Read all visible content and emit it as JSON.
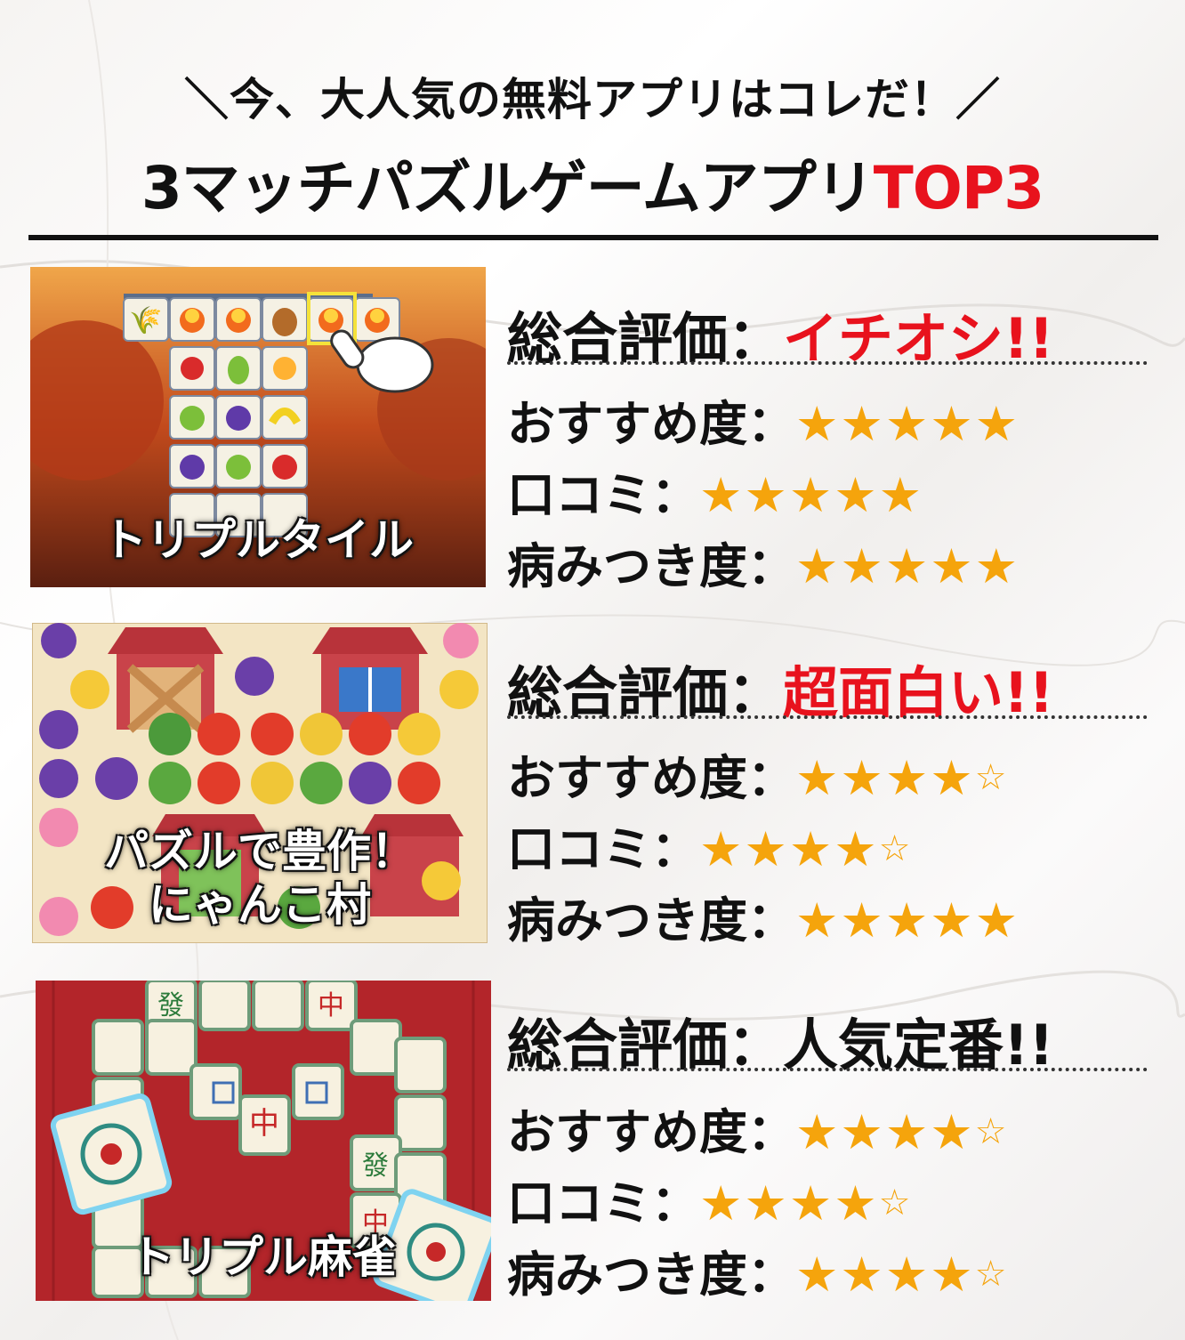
{
  "header": {
    "subtitle": "＼今、大人気の無料アプリはコレだ！／",
    "title_main": "3マッチパズルゲームアプリ",
    "title_accent": "TOP3"
  },
  "labels": {
    "overall": "総合評価：",
    "recommend": "おすすめ度：",
    "reviews": "口コミ：",
    "addictive": "病みつき度："
  },
  "star_colors": {
    "filled": "#f5a40c"
  },
  "apps": [
    {
      "caption_line1": "トリプルタイル",
      "caption_line2": "",
      "verdict": "イチオシ!!",
      "recommend_stars": "★★★★★",
      "recommend_empty": "",
      "reviews_stars": "★★★★★",
      "reviews_empty": "",
      "addictive_stars": "★★★★★",
      "addictive_empty": "",
      "recommend_rating": 5,
      "reviews_rating": 5,
      "addictive_rating": 5
    },
    {
      "caption_line1": "パズルで豊作！",
      "caption_line2": "にゃんこ村",
      "verdict": "超面白い!!",
      "recommend_stars": "★★★★",
      "recommend_empty": "☆",
      "reviews_stars": "★★★★",
      "reviews_empty": "☆",
      "addictive_stars": "★★★★★",
      "addictive_empty": "",
      "recommend_rating": 4,
      "reviews_rating": 4,
      "addictive_rating": 5
    },
    {
      "caption_line1": "トリプル麻雀",
      "caption_line2": "",
      "verdict": "人気定番!!",
      "recommend_stars": "★★★★",
      "recommend_empty": "☆",
      "reviews_stars": "★★★★",
      "reviews_empty": "☆",
      "addictive_stars": "★★★★",
      "addictive_empty": "☆",
      "recommend_rating": 4,
      "reviews_rating": 4,
      "addictive_rating": 4
    }
  ]
}
